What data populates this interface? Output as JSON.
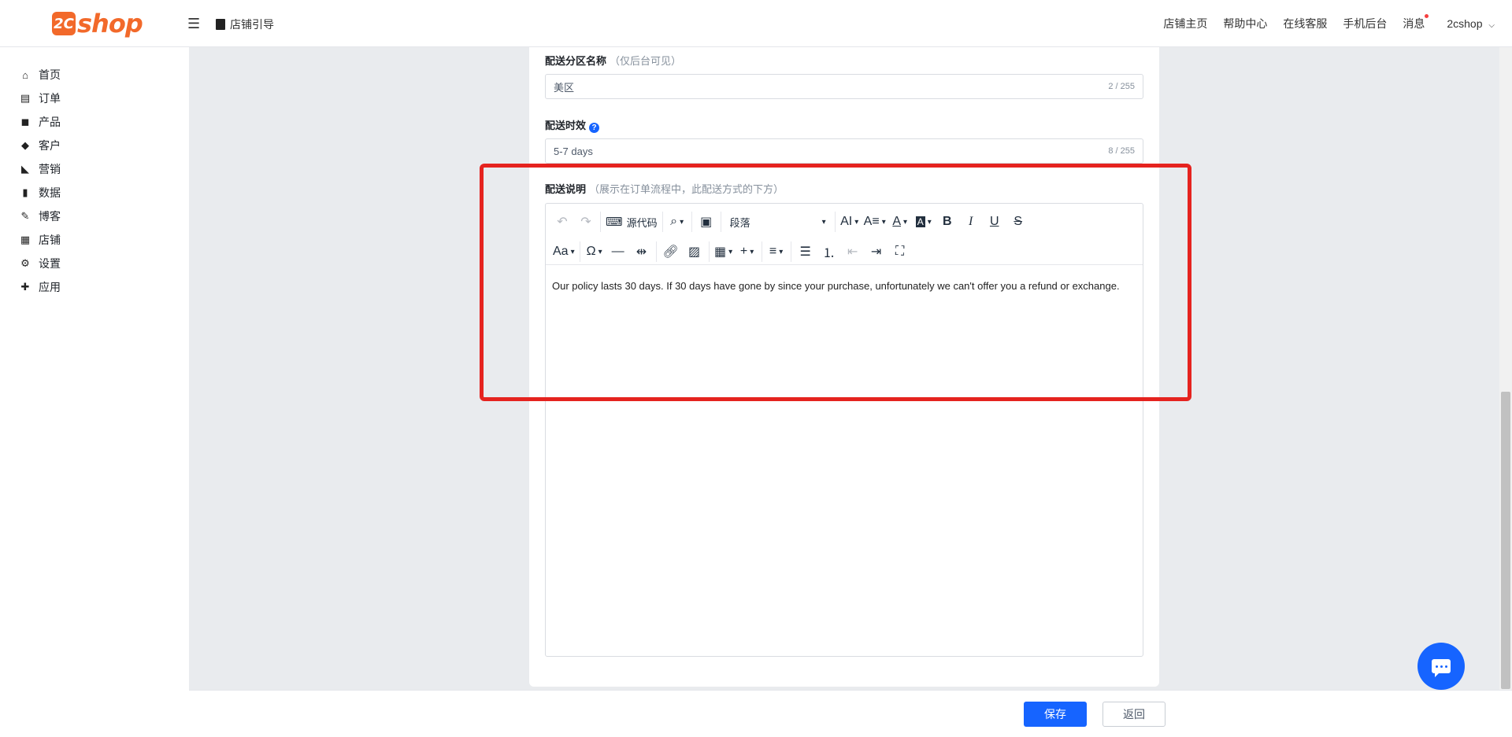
{
  "header": {
    "logo_mark": "2C",
    "logo_word": "shop",
    "guide_label": "店铺引导",
    "nav": [
      "店铺主页",
      "帮助中心",
      "在线客服",
      "手机后台",
      "消息"
    ],
    "user": "2cshop"
  },
  "sidebar": {
    "items": [
      {
        "label": "首页",
        "icon": "home-icon",
        "glyph": "⌂"
      },
      {
        "label": "订单",
        "icon": "clipboard-icon",
        "glyph": "▤"
      },
      {
        "label": "产品",
        "icon": "bag-icon",
        "glyph": "◼"
      },
      {
        "label": "客户",
        "icon": "gem-icon",
        "glyph": "◆"
      },
      {
        "label": "营销",
        "icon": "tag-icon",
        "glyph": "◣"
      },
      {
        "label": "数据",
        "icon": "bar-chart-icon",
        "glyph": "▮"
      },
      {
        "label": "博客",
        "icon": "edit-icon",
        "glyph": "✎"
      },
      {
        "label": "店铺",
        "icon": "store-icon",
        "glyph": "▦"
      },
      {
        "label": "设置",
        "icon": "gear-icon",
        "glyph": "⚙"
      },
      {
        "label": "应用",
        "icon": "puzzle-icon",
        "glyph": "✚"
      }
    ]
  },
  "form": {
    "zone_name": {
      "label": "配送分区名称",
      "hint": "（仅后台可见）",
      "value": "美区",
      "count": "2 / 255"
    },
    "delivery_time": {
      "label": "配送时效",
      "help": "?",
      "value": "5-7 days",
      "count": "8 / 255"
    },
    "description": {
      "label": "配送说明",
      "hint": "（展示在订单流程中，此配送方式的下方）",
      "content": "Our policy lasts 30 days. If 30 days have gone by since your purchase, unfortunately we can't offer you a refund or exchange."
    }
  },
  "editor_toolbar": {
    "source_code": "源代码",
    "paragraph": "段落"
  },
  "footer": {
    "save": "保存",
    "back": "返回"
  },
  "colors": {
    "brand": "#f2692a",
    "primary": "#1664ff",
    "highlight": "#e5231f"
  }
}
